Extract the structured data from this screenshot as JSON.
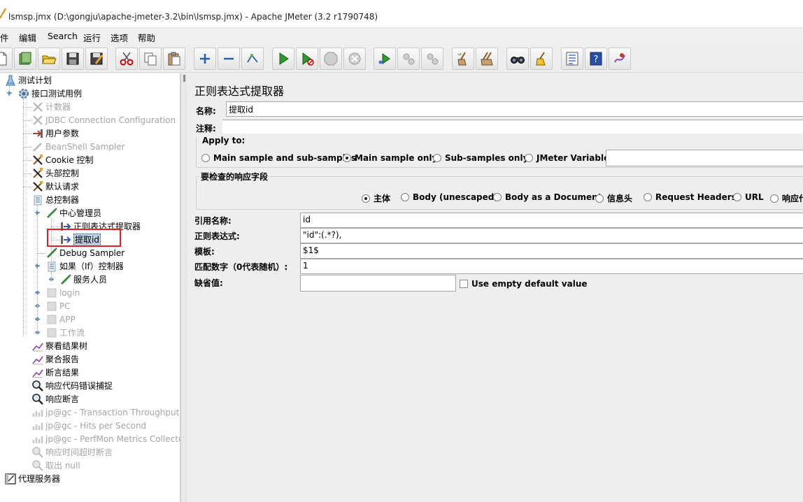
{
  "window": {
    "title": "lsmsp.jmx (D:\\gongju\\apache-jmeter-3.2\\bin\\lsmsp.jmx) - Apache JMeter (3.2 r1790748)"
  },
  "menu": {
    "items": [
      "件",
      "编辑",
      "Search",
      "运行",
      "选项",
      "帮助"
    ]
  },
  "toolbar": {
    "icons": [
      "new-icon",
      "templates-icon",
      "open-icon",
      "save-icon",
      "save-as-icon",
      "cut-icon",
      "copy-icon",
      "paste-icon",
      "expand-icon",
      "collapse-icon",
      "toggle-icon",
      "start-icon",
      "start-no-timers-icon",
      "stop-icon",
      "shutdown-icon",
      "remote-start-icon",
      "remote-stop-icon",
      "remote-exit-icon",
      "clear-icon",
      "clear-all-icon",
      "search-icon",
      "reset-search-icon",
      "function-helper-icon",
      "help-icon",
      "log-viewer-icon"
    ]
  },
  "tree": {
    "nodes": [
      {
        "label": "测试计划",
        "enabled": true
      },
      {
        "label": "接口测试用例",
        "enabled": true
      },
      {
        "label": "计数器",
        "enabled": false
      },
      {
        "label": "JDBC Connection Configuration",
        "enabled": false
      },
      {
        "label": "用户参数",
        "enabled": true
      },
      {
        "label": "BeanShell Sampler",
        "enabled": false
      },
      {
        "label": "Cookie 控制",
        "enabled": true
      },
      {
        "label": "头部控制",
        "enabled": true
      },
      {
        "label": "默认请求",
        "enabled": true
      },
      {
        "label": "总控制器",
        "enabled": true
      },
      {
        "label": "中心管理员",
        "enabled": true
      },
      {
        "label": "正则表达式提取器",
        "enabled": true
      },
      {
        "label": "提取id",
        "enabled": true,
        "selected": true
      },
      {
        "label": "Debug Sampler",
        "enabled": true
      },
      {
        "label": "如果（If）控制器",
        "enabled": true
      },
      {
        "label": "服务人员",
        "enabled": true
      },
      {
        "label": "login",
        "enabled": false
      },
      {
        "label": "PC",
        "enabled": false
      },
      {
        "label": "APP",
        "enabled": false
      },
      {
        "label": "工作流",
        "enabled": false
      },
      {
        "label": "察看结果树",
        "enabled": true
      },
      {
        "label": "聚合报告",
        "enabled": true
      },
      {
        "label": "断言结果",
        "enabled": true
      },
      {
        "label": "响应代码错误捕捉",
        "enabled": true
      },
      {
        "label": "响应断言",
        "enabled": true
      },
      {
        "label": "jp@gc - Transaction Throughput vs",
        "enabled": false
      },
      {
        "label": "jp@gc - Hits per Second",
        "enabled": false
      },
      {
        "label": "jp@gc - PerfMon Metrics Collector",
        "enabled": false
      },
      {
        "label": "响应时间超时断言",
        "enabled": false
      },
      {
        "label": "取出 null",
        "enabled": false
      },
      {
        "label": "代理服务器",
        "enabled": true
      }
    ]
  },
  "editor": {
    "title": "正则表达式提取器",
    "name_label": "名称:",
    "name_value": "提取id",
    "comment_label": "注释:",
    "comment_value": "",
    "apply_to": {
      "legend": "Apply to:",
      "options": [
        "Main sample and sub-samples",
        "Main sample only",
        "Sub-samples only",
        "JMeter Variable"
      ],
      "selected": "Main sample only",
      "variable_value": ""
    },
    "response_field": {
      "legend": "要检查的响应字段",
      "options": [
        "主体",
        "Body (unescaped)",
        "Body as a Document",
        "信息头",
        "Request Headers",
        "URL",
        "响应代"
      ],
      "selected": "主体"
    },
    "fields": {
      "ref_name_label": "引用名称:",
      "ref_name_value": "id",
      "regex_label": "正则表达式:",
      "regex_value": "\"id\":(.*?),",
      "template_label": "模板:",
      "template_value": "$1$",
      "match_no_label": "匹配数字（0代表随机）:",
      "match_no_value": "1",
      "default_label": "缺省值:",
      "default_value": "",
      "use_empty_label": "Use empty default value"
    }
  }
}
